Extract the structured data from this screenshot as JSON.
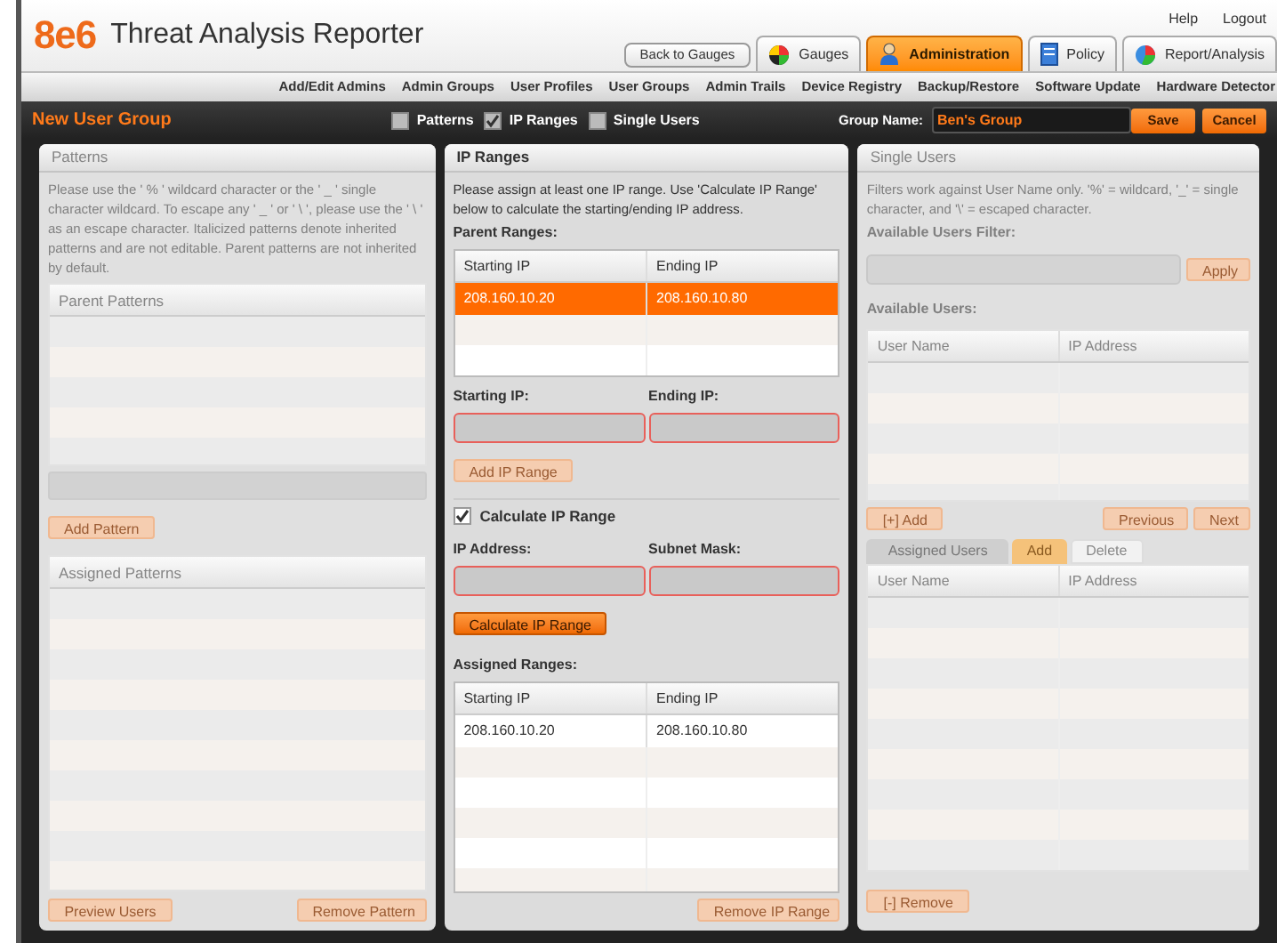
{
  "header": {
    "logo": "8e6",
    "title": "Threat Analysis Reporter",
    "links": [
      "Help",
      "Logout"
    ],
    "back_button": "Back to Gauges",
    "tabs": [
      {
        "label": "Gauges",
        "kind": "gauges",
        "selected": false
      },
      {
        "label": "Administration",
        "kind": "admin",
        "selected": true
      },
      {
        "label": "Policy",
        "kind": "policy",
        "selected": false
      },
      {
        "label": "Report/Analysis",
        "kind": "report",
        "selected": false
      }
    ]
  },
  "subnav": [
    "Add/Edit Admins",
    "Admin Groups",
    "User Profiles",
    "User Groups",
    "Admin Trails",
    "Device Registry",
    "Backup/Restore",
    "Software Update",
    "Hardware Detector"
  ],
  "toolbar": {
    "title": "New User Group",
    "sections": [
      {
        "label": "Patterns",
        "checked": false
      },
      {
        "label": "IP Ranges",
        "checked": true
      },
      {
        "label": "Single Users",
        "checked": false
      }
    ],
    "group_name_label": "Group Name:",
    "group_name_value": "Ben's Group",
    "buttons": [
      "Save",
      "Cancel"
    ]
  },
  "patterns_panel": {
    "title": "Patterns",
    "description": "Please use the ' % ' wildcard character or the ' _ ' single character wildcard.  To escape any ' _ ' or ' \\ ', please use the ' \\ ' as an escape character.  Italicized patterns denote inherited patterns and are not editable.  Parent patterns are not inherited by default.",
    "parent_header": "Parent Patterns",
    "add_button": "Add Pattern",
    "assigned_header": "Assigned Patterns",
    "buttons": [
      "Preview Users",
      "Remove Pattern"
    ]
  },
  "ip_panel": {
    "title": "IP Ranges",
    "description": "Please assign at least one IP range.  Use 'Calculate IP Range' below to calculate the starting/ending IP address.",
    "parent_label": "Parent Ranges:",
    "parent_table": {
      "columns": [
        "Starting IP",
        "Ending IP"
      ],
      "rows": [
        {
          "cells": [
            "208.160.10.20",
            "208.160.10.80"
          ],
          "selected": true
        }
      ]
    },
    "start_label": "Starting IP:",
    "end_label": "Ending IP:",
    "add_button": "Add IP Range",
    "calculate": {
      "label": "Calculate IP Range",
      "checked": true
    },
    "ip_label": "IP Address:",
    "mask_label": "Subnet Mask:",
    "calc_button": "Calculate IP Range",
    "assigned_label": "Assigned Ranges:",
    "assigned_table": {
      "columns": [
        "Starting IP",
        "Ending IP"
      ],
      "rows": [
        {
          "cells": [
            "208.160.10.20",
            "208.160.10.80"
          ],
          "selected": false
        }
      ]
    },
    "remove_button": "Remove IP Range"
  },
  "users_panel": {
    "title": "Single Users",
    "description": "Filters work against User Name only.  '%' = wildcard, '_' = single character, and '\\' = escaped character.",
    "filter_label": "Available Users Filter:",
    "apply_button": "Apply",
    "available_label": "Available Users:",
    "available_columns": [
      "User Name",
      "IP Address"
    ],
    "add_button": "[+] Add",
    "paging": [
      "Previous",
      "Next"
    ],
    "tabs": [
      {
        "label": "Assigned Users",
        "selected": false
      },
      {
        "label": "Add",
        "selected": true
      },
      {
        "label": "Delete",
        "selected": false
      }
    ],
    "assigned_columns": [
      "User Name",
      "IP Address"
    ],
    "remove_button": "[-] Remove"
  }
}
